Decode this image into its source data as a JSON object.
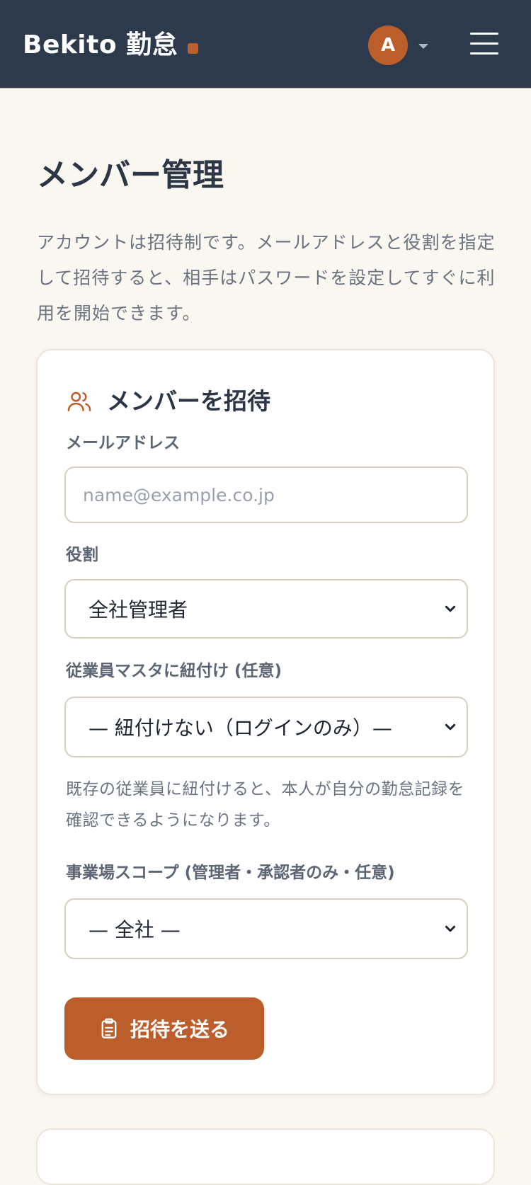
{
  "header": {
    "brand": "Bekito 勤怠",
    "avatar_initial": "A",
    "colors": {
      "bar": "#2c3a4c",
      "accent": "#bb5e2c"
    }
  },
  "page": {
    "title": "メンバー管理",
    "description": "アカウントは招待制です。メールアドレスと役割を指定して招待すると、相手はパスワードを設定してすぐに利用を開始できます。"
  },
  "invite": {
    "title": "メンバーを招待",
    "email_label": "メールアドレス",
    "email_placeholder": "name@example.co.jp",
    "email_value": "",
    "role_label": "役割",
    "role_value": "全社管理者",
    "employee_label": "従業員マスタに紐付け (任意)",
    "employee_value": "— 紐付けない（ログインのみ）—",
    "employee_hint": "既存の従業員に紐付けると、本人が自分の勤怠記録を確認できるようになります。",
    "scope_label": "事業場スコープ (管理者・承認者のみ・任意)",
    "scope_value": "— 全社 —",
    "submit_label": "招待を送る"
  }
}
